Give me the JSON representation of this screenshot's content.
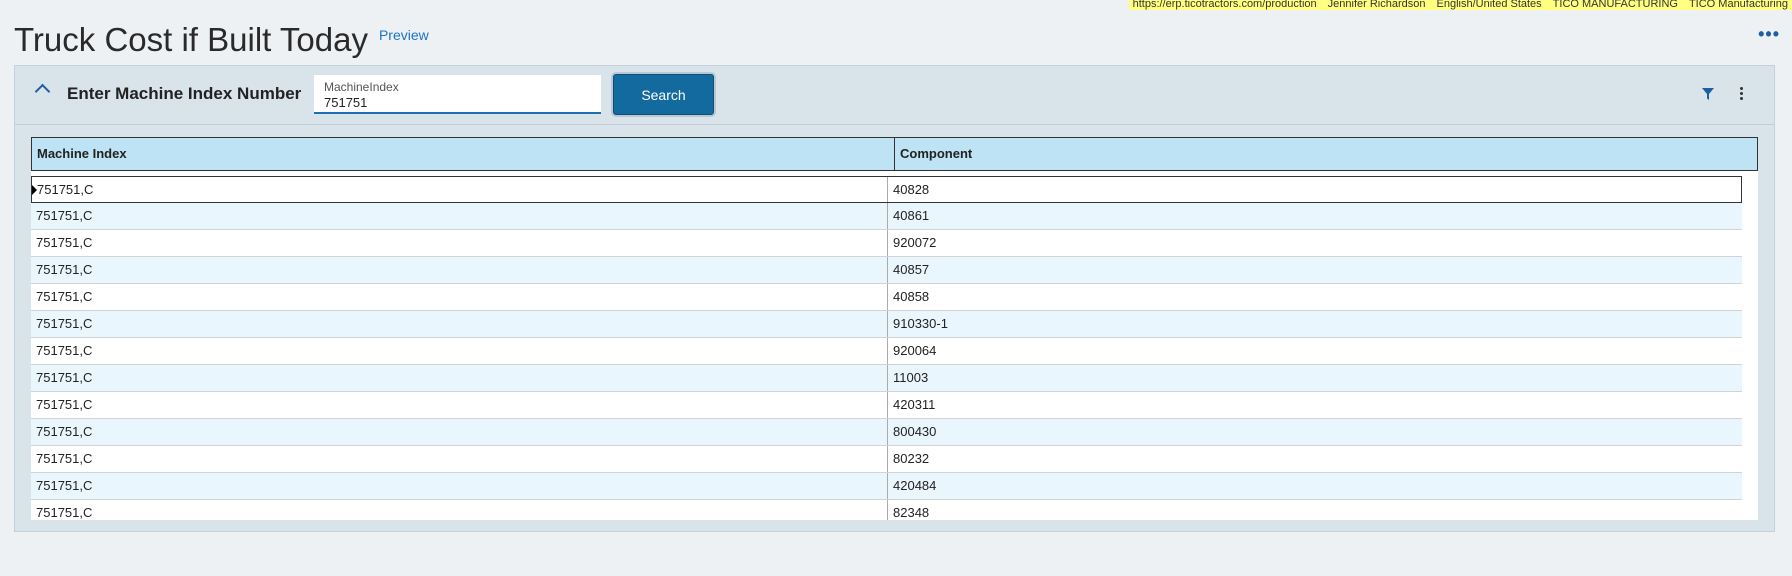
{
  "env": [
    "https://erp.ticotractors.com/production",
    "Jennifer Richardson",
    "English/United States",
    "TICO MANUFACTURING",
    "TICO Manufacturing"
  ],
  "page": {
    "title": "Truck Cost if Built Today",
    "preview_label": "Preview"
  },
  "panel": {
    "title": "Enter Machine Index Number",
    "field_label": "MachineIndex",
    "field_value": "751751",
    "search_label": "Search"
  },
  "grid": {
    "columns": [
      "Machine Index",
      "Component"
    ],
    "rows": [
      [
        "751751,C",
        "40828"
      ],
      [
        "751751,C",
        "40861"
      ],
      [
        "751751,C",
        "920072"
      ],
      [
        "751751,C",
        "40857"
      ],
      [
        "751751,C",
        "40858"
      ],
      [
        "751751,C",
        "910330-1"
      ],
      [
        "751751,C",
        "920064"
      ],
      [
        "751751,C",
        "11003"
      ],
      [
        "751751,C",
        "420311"
      ],
      [
        "751751,C",
        "800430"
      ],
      [
        "751751,C",
        "80232"
      ],
      [
        "751751,C",
        "420484"
      ],
      [
        "751751,C",
        "82348"
      ]
    ]
  },
  "colors": {
    "accent": "#126a9e",
    "header_bg": "#bde3f5",
    "alt_row": "#eaf6fd",
    "env_bar": "#ffff80"
  },
  "icons": {
    "collapse": "chevron-up-icon",
    "filter": "filter-icon",
    "more": "more-vertical-icon",
    "more_top": "more-horizontal-icon"
  }
}
